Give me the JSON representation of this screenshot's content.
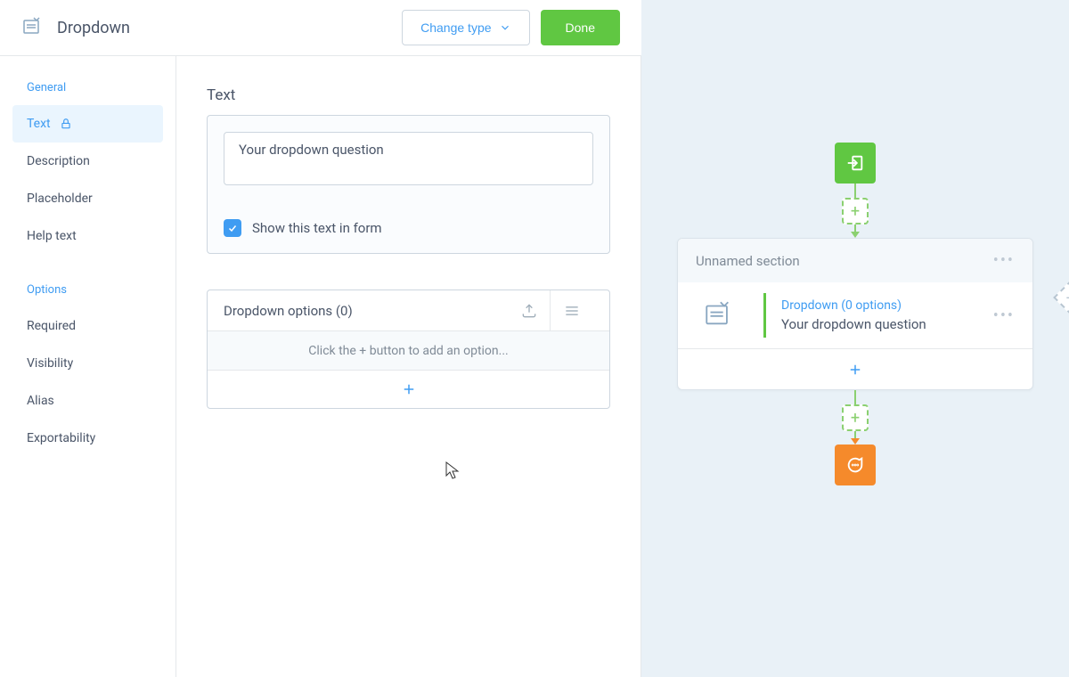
{
  "header": {
    "title": "Dropdown",
    "change_type_label": "Change type",
    "done_label": "Done"
  },
  "sidebar": {
    "group1_label": "General",
    "items1": {
      "text": "Text",
      "description": "Description",
      "placeholder": "Placeholder",
      "help_text": "Help text"
    },
    "group2_label": "Options",
    "items2": {
      "required": "Required",
      "visibility": "Visibility",
      "alias": "Alias",
      "exportability": "Exportability"
    }
  },
  "main": {
    "text_section_title": "Text",
    "question_value": "Your dropdown question",
    "show_in_form_label": "Show this text in form",
    "options_header": "Dropdown options (0)",
    "options_empty_hint": "Click the + button to add an option..."
  },
  "preview": {
    "section_title": "Unnamed section",
    "question_type_label": "Dropdown (0 options)",
    "question_text": "Your dropdown question"
  },
  "icons": {
    "plus": "+"
  }
}
